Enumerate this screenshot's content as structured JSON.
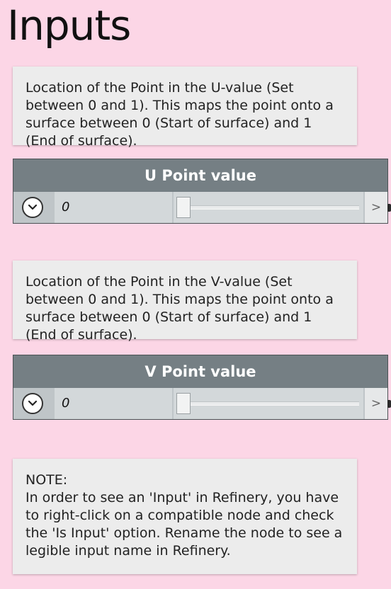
{
  "page": {
    "title": "Inputs"
  },
  "notes": {
    "u_description": "Location of the Point in the U-value (Set between 0 and 1). This maps the point onto a surface between 0 (Start of surface) and 1 (End of surface).",
    "v_description": "Location of the Point in the V-value (Set between 0 and 1). This maps the point onto a surface between 0 (Start of surface) and 1 (End of surface).",
    "refinery_note": {
      "heading": "NOTE:",
      "body": "In order to see an 'Input' in Refinery, you have to right-click on a compatible node and check the 'Is Input' option. Rename the node to see a legible input name in Refinery."
    }
  },
  "nodes": [
    {
      "title": "U Point value",
      "value": "0",
      "slider_fraction": 0,
      "expand_glyph": ">"
    },
    {
      "title": "V Point value",
      "value": "0",
      "slider_fraction": 0,
      "expand_glyph": ">"
    }
  ],
  "colors": {
    "background": "#fcd6e6",
    "node_header": "#757f84",
    "note_bg": "#ececec"
  },
  "icons": {
    "dropdown": "chevron-down-icon"
  }
}
